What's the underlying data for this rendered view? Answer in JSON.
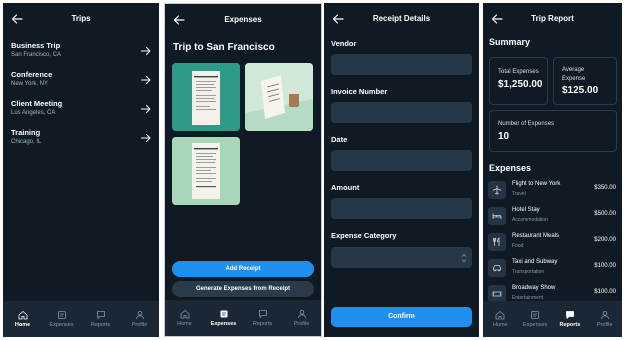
{
  "colors": {
    "background": "#0f1a24",
    "nav": "#1a2734",
    "accent": "#1f8ff0",
    "field": "#263748"
  },
  "nav_items": [
    {
      "label": "Home",
      "icon": "home-icon"
    },
    {
      "label": "Expenses",
      "icon": "receipt-icon"
    },
    {
      "label": "Reports",
      "icon": "chat-icon"
    },
    {
      "label": "Profile",
      "icon": "user-icon"
    }
  ],
  "trips_screen": {
    "title": "Trips",
    "trips": [
      {
        "name": "Business Trip",
        "location": "San Francisco, CA"
      },
      {
        "name": "Conference",
        "location": "New York, NY"
      },
      {
        "name": "Client Meeting",
        "location": "Los Angeles, CA"
      },
      {
        "name": "Training",
        "location": "Chicago, IL"
      }
    ],
    "active_nav": "Home"
  },
  "expenses_screen": {
    "title": "Expenses",
    "subtitle": "Trip to San Francisco",
    "receipt_headers": [
      "RECEIPT",
      "",
      "RECEIPT"
    ],
    "add_button": "Add Receipt",
    "generate_button": "Generate Expenses from Receipt",
    "active_nav": "Expenses"
  },
  "receipt_details_screen": {
    "title": "Receipt Details",
    "fields": [
      {
        "label": "Vendor",
        "value": ""
      },
      {
        "label": "Invoice Number",
        "value": ""
      },
      {
        "label": "Date",
        "value": ""
      },
      {
        "label": "Amount",
        "value": ""
      },
      {
        "label": "Expense Category",
        "value": ""
      }
    ],
    "confirm_button": "Confirm"
  },
  "trip_report_screen": {
    "title": "Trip Report",
    "summary_heading": "Summary",
    "total_label": "Total Expenses",
    "total_value": "$1,250.00",
    "average_label": "Average Expense",
    "average_value": "$125.00",
    "count_label": "Number of Expenses",
    "count_value": "10",
    "expenses_heading": "Expenses",
    "expenses": [
      {
        "name": "Flight to New York",
        "category": "Travel",
        "amount": "$350.00",
        "icon": "airplane-icon"
      },
      {
        "name": "Hotel Stay",
        "category": "Accommodation",
        "amount": "$500.00",
        "icon": "bed-icon"
      },
      {
        "name": "Restaurant Meals",
        "category": "Food",
        "amount": "$200.00",
        "icon": "utensils-icon"
      },
      {
        "name": "Taxi and Subway",
        "category": "Transportation",
        "amount": "$100.00",
        "icon": "car-icon"
      },
      {
        "name": "Broadway Show",
        "category": "Entertainment",
        "amount": "$100.00",
        "icon": "ticket-icon"
      }
    ],
    "active_nav": "Reports"
  }
}
